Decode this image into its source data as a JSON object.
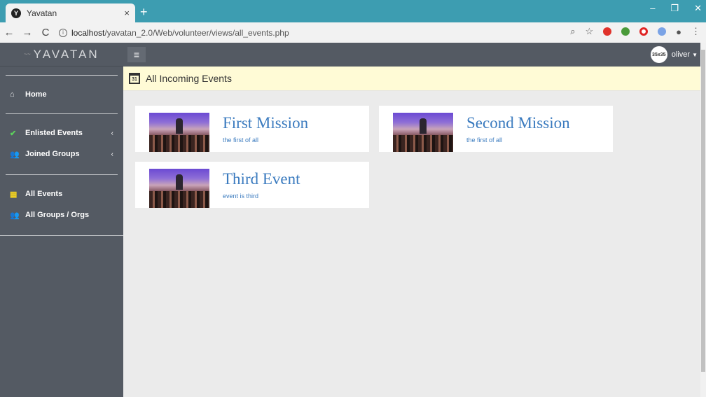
{
  "browser": {
    "tab_title": "Yavatan",
    "tab_close": "×",
    "new_tab": "+",
    "favicon_letter": "Y",
    "url_host": "localhost",
    "url_path": "/yavatan_2.0/Web/volunteer/views/all_events.php",
    "back_icon": "←",
    "forward_icon": "→",
    "reload_icon": "C",
    "minimize": "–",
    "restore": "❐",
    "close": "✕"
  },
  "app": {
    "brand": "YAVATAN",
    "user_name": "oliver",
    "avatar_text": "35x35",
    "menu_icon": "≡"
  },
  "sidebar": {
    "home": "Home",
    "enlisted_events": "Enlisted Events",
    "joined_groups": "Joined Groups",
    "all_events": "All Events",
    "all_groups": "All Groups / Orgs",
    "chevron": "‹"
  },
  "page": {
    "title": "All Incoming Events",
    "cal_day": "31"
  },
  "events": [
    {
      "title": "First Mission",
      "subtitle": "the first of all"
    },
    {
      "title": "Second Mission",
      "subtitle": "the first of all"
    },
    {
      "title": "Third Event",
      "subtitle": "event is third"
    }
  ],
  "colors": {
    "accent_link": "#3b7bbf",
    "sidebar_bg": "#545a63",
    "header_bg": "#fffbd6",
    "browser_bar": "#3d9db1"
  }
}
